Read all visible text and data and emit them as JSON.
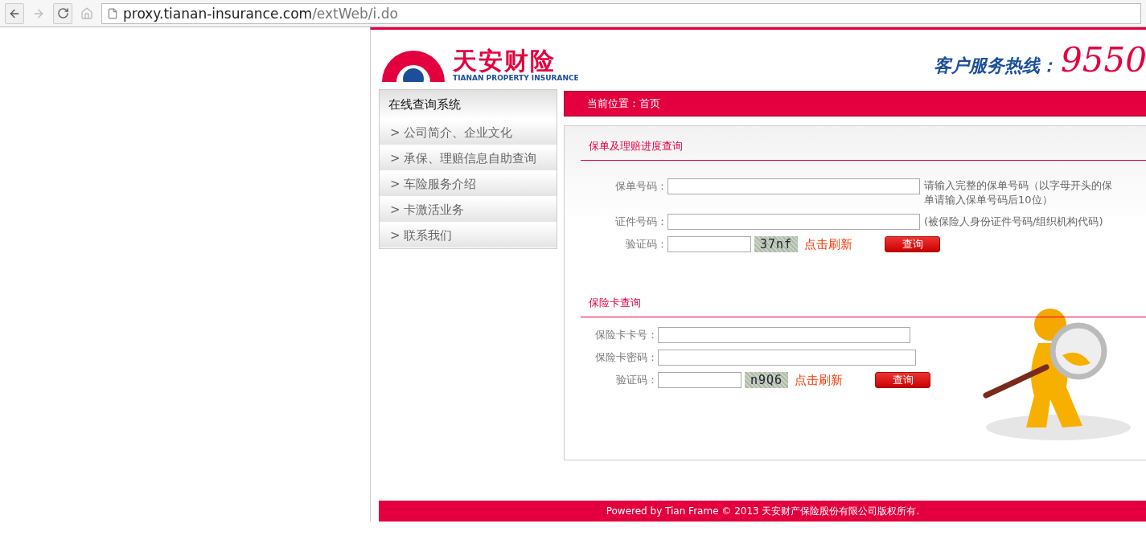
{
  "browser": {
    "url_host": "proxy.tianan-insurance.com",
    "url_path": "/extWeb/i.do"
  },
  "header": {
    "brand_cn": "天安财险",
    "brand_en": "TIANAN PROPERTY INSURANCE",
    "hotline_label": "客户服务热线：",
    "hotline_number": "9550"
  },
  "sidebar": {
    "title": "在线查询系统",
    "items": [
      {
        "arrow": ">",
        "label": "公司简介、企业文化"
      },
      {
        "arrow": ">",
        "label": "承保、理赔信息自助查询"
      },
      {
        "arrow": ">",
        "label": "车险服务介绍"
      },
      {
        "arrow": ">",
        "label": "卡激活业务"
      },
      {
        "arrow": ">",
        "label": "联系我们"
      }
    ]
  },
  "breadcrumb": "当前位置：首页",
  "sections": [
    {
      "title": "保单及理赔进度查询",
      "fields": [
        {
          "kind": "text",
          "label": "保单号码：",
          "hint": "请输入完整的保单号码（以字母开头的保单请输入保单号码后10位）"
        },
        {
          "kind": "text",
          "label": "证件号码：",
          "hint": "(被保险人身份证件号码/组织机构代码)"
        },
        {
          "kind": "captcha",
          "label": "验证码：",
          "captcha": "37nf",
          "refresh": "点击刷新",
          "button": "查询"
        }
      ]
    },
    {
      "title": "保险卡查询",
      "fields": [
        {
          "kind": "text",
          "label": "保险卡卡号："
        },
        {
          "kind": "text",
          "label": "保险卡密码："
        },
        {
          "kind": "captcha",
          "label": "验证码：",
          "captcha": "n9Q6",
          "refresh": "点击刷新",
          "button": "查询"
        }
      ]
    }
  ],
  "footer": "Powered by Tian Frame © 2013 天安财产保险股份有限公司版权所有."
}
